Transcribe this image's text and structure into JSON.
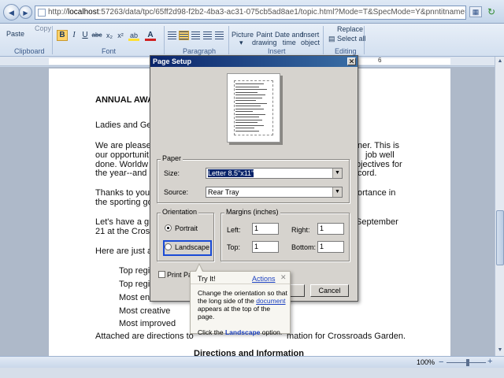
{
  "browser": {
    "back_glyph": "◀",
    "forward_glyph": "▶",
    "address_prefix": "http://",
    "address_host": "localhost",
    "address_rest": ":57263/data/tpc/65ff2d98-f2b2-4ba3-ac31-075cb5ad8ae1/topic.html?Mode=T&SpecMode=Y&pnntitname=65ff2d98-f2b2-4ba3-ac31-075cb5ad8a"
  },
  "ribbon": {
    "paste_label": "Paste",
    "copy_label": "Copy",
    "clipboard_label": "Clipboard",
    "font_label": "Font",
    "paragraph_label": "Paragraph",
    "insert_label": "Insert",
    "editing_label": "Editing",
    "bold": "B",
    "italic": "I",
    "underline": "U",
    "strike": "abc",
    "subscript": "x₂",
    "superscript": "x²",
    "highlight": "ab",
    "font_color": "A",
    "picture": "Picture",
    "paint_drawing": "Paint\ndrawing",
    "date_time": "Date and\ntime",
    "insert_object": "Insert\nobject",
    "replace": "Replace",
    "select_all": "Select all"
  },
  "ruler": {
    "left_label": "1",
    "right_label": "6"
  },
  "document": {
    "heading": "ANNUAL AWA",
    "line1": "Ladies and Ger",
    "line2a": "We are pleased",
    "line2a_r": "ner.  This is",
    "line2b": "our opportunit",
    "line2b_r": "job well",
    "line2c": "done.  Worldw",
    "line2c_r": "bjectives for",
    "line2d": "the year--and",
    "line2d_r": "cord.",
    "line3a": "Thanks to you",
    "line3a_r": "ortance in",
    "line3b": "the sporting go",
    "line4a": "Let's have a gr",
    "line4a_r": "September",
    "line4b": "21 at the Cros",
    "line5": "Here are just a",
    "bullet1": "Top regi",
    "bullet2": "Top regi",
    "bullet3": "Most en",
    "bullet4": "Most creative",
    "bullet5": "Most improved",
    "line6_left": "Attached are directions to",
    "line6_right": "mation for Crossroads Garden.",
    "directions_heading": "Directions and Information"
  },
  "dialog": {
    "title": "Page Setup",
    "close_glyph": "✕",
    "paper_group": "Paper",
    "size_label": "Size:",
    "size_value": "Letter 8.5\"x11\"",
    "source_label": "Source:",
    "source_value": "Rear Tray",
    "orientation_group": "Orientation",
    "portrait_label": "Portrait",
    "landscape_label": "Landscape",
    "margins_group": "Margins (inches)",
    "left_label": "Left:",
    "left_value": "1",
    "right_label": "Right:",
    "right_value": "1",
    "top_label": "Top:",
    "top_value": "1",
    "bottom_label": "Bottom:",
    "bottom_value": "1",
    "print_page_label": "Print Page",
    "cancel_label": "Cancel"
  },
  "tooltip": {
    "title": "Try It!",
    "actions": "Actions",
    "close_glyph": "✕",
    "body_part1": "Change the orientation so that the long side of the ",
    "body_link": "document",
    "body_part2": " appears at the top of the page.",
    "instruction_prefix": "Click the ",
    "instruction_bold": "Landscape",
    "instruction_suffix": " option."
  },
  "status": {
    "zoom": "100%",
    "zoom_minus": "−",
    "zoom_plus": "+"
  }
}
